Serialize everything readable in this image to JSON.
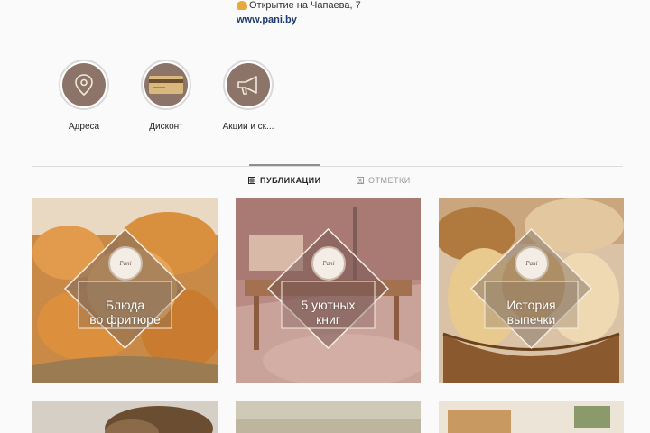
{
  "bio": {
    "line1": "Открытие на Чапаева, 7",
    "link": "www.pani.by"
  },
  "highlights": [
    {
      "label": "Адреса",
      "icon": "location-pin-icon"
    },
    {
      "label": "Дисконт",
      "icon": "discount-card-icon"
    },
    {
      "label": "Акции и ск...",
      "icon": "megaphone-icon"
    }
  ],
  "tabs": {
    "posts": "ПУБЛИКАЦИИ",
    "tagged": "ОТМЕТКИ"
  },
  "posts": [
    {
      "title_line1": "Блюда",
      "title_line2": "во фритюре",
      "badge": "Pani"
    },
    {
      "title_line1": "5 уютных",
      "title_line2": "книг",
      "badge": "Pani"
    },
    {
      "title_line1": "История",
      "title_line2": "выпечки",
      "badge": "Pani"
    }
  ],
  "colors": {
    "link": "#1f3a6e",
    "highlight_fill": "#8c7468",
    "badge_fill": "#f3ede6"
  }
}
